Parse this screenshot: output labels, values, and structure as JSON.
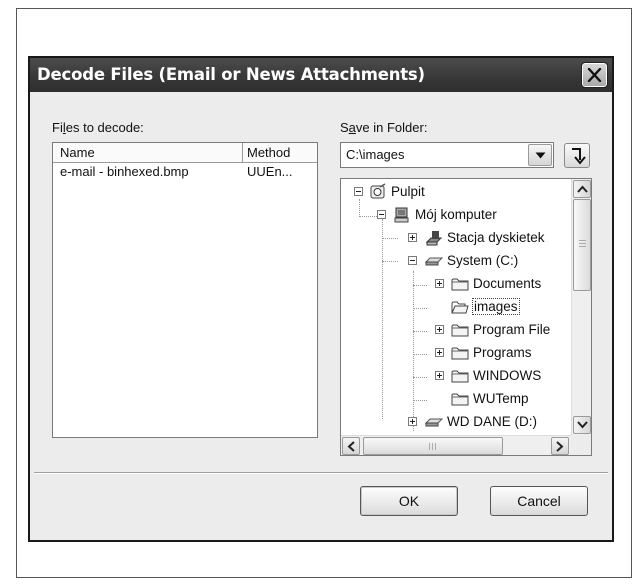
{
  "dialog": {
    "title": "Decode Files (Email or News Attachments)"
  },
  "files_panel": {
    "label_prefix": "Fi",
    "label_accel": "l",
    "label_suffix": "es to decode:",
    "columns": {
      "name": "Name",
      "method": "Method"
    },
    "rows": [
      {
        "name": "e-mail - binhexed.bmp",
        "method": "UUEn..."
      }
    ]
  },
  "save_panel": {
    "label_prefix": "S",
    "label_accel": "a",
    "label_suffix": "ve in Folder:",
    "folder_value": "C:\\images",
    "tree": [
      {
        "label": "Pulpit",
        "icon": "desktop-icon"
      },
      {
        "label": "Mój komputer",
        "icon": "computer-icon"
      },
      {
        "label": "Stacja dyskietek",
        "icon": "floppy-drive-icon"
      },
      {
        "label": "System (C:)",
        "icon": "hard-drive-icon"
      },
      {
        "label": "Documents",
        "icon": "folder-icon"
      },
      {
        "label": "images",
        "icon": "folder-icon",
        "selected": true
      },
      {
        "label": "Program File",
        "icon": "folder-icon"
      },
      {
        "label": "Programs",
        "icon": "folder-icon"
      },
      {
        "label": "WINDOWS",
        "icon": "folder-icon"
      },
      {
        "label": "WUTemp",
        "icon": "folder-icon"
      },
      {
        "label": "WD DANE (D:)",
        "icon": "hard-drive-icon"
      }
    ]
  },
  "buttons": {
    "ok": "OK",
    "cancel": "Cancel"
  },
  "colors": {
    "titlebar": "#3a3a3a",
    "dialog_bg": "#ececec"
  }
}
